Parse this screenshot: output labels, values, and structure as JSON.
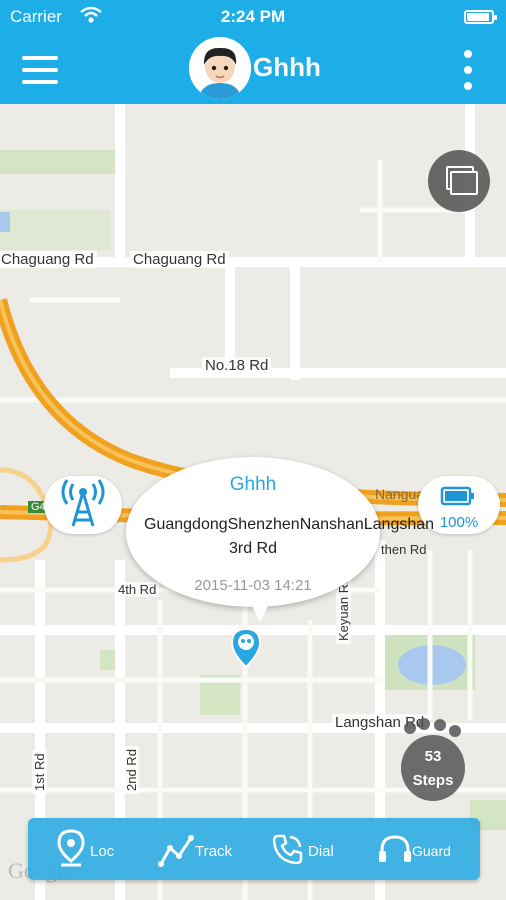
{
  "status_bar": {
    "carrier": "Carrier",
    "time": "2:24 PM",
    "battery_level": 1.0
  },
  "header": {
    "title": "Ghhh"
  },
  "map": {
    "road_labels": [
      "Chaguang Rd",
      "Chaguang Rd",
      "No.18 Rd",
      "4th Rd",
      "Keyuan Rd",
      "Langshan Rd",
      "1st Rd",
      "2nd Rd",
      "Nanguang Exp",
      "then Rd",
      "G4"
    ],
    "watermark": "Google"
  },
  "device": {
    "battery_percent": "100%",
    "popup": {
      "name": "Ghhh",
      "address": "GuangdongShenzhenNanshanLangshan 3rd Rd",
      "timestamp": "2015-11-03 14:21"
    },
    "steps": {
      "count": "53",
      "label": "Steps"
    }
  },
  "toolbar": {
    "loc": "Loc",
    "track": "Track",
    "dial": "Dial",
    "guard": "Guard"
  },
  "colors": {
    "primary": "#1daee8",
    "toolbar": "#33aee3",
    "expressway": "#f0a11f",
    "pin": "#29a8e0"
  }
}
